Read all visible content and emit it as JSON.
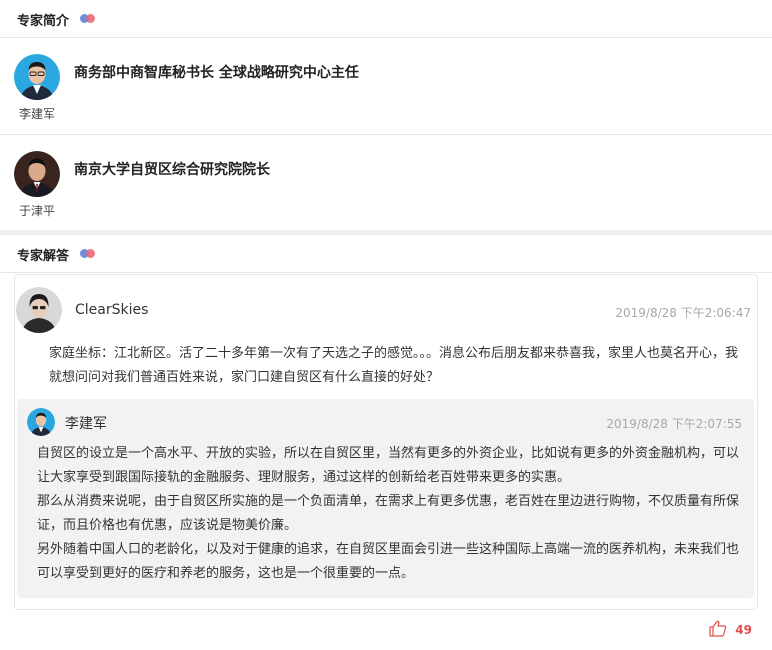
{
  "intro_section": {
    "title": "专家简介"
  },
  "experts": [
    {
      "name": "李建军",
      "title": "商务部中商智库秘书长 全球战略研究中心主任",
      "avatar_icon": "person-avatar-icon"
    },
    {
      "name": "于津平",
      "title": "南京大学自贸区综合研究院院长",
      "avatar_icon": "person-avatar-icon"
    }
  ],
  "qa_section": {
    "title": "专家解答"
  },
  "question": {
    "user": "ClearSkies",
    "time": "2019/8/28 下午2:06:47",
    "text": "家庭坐标：江北新区。活了二十多年第一次有了天选之子的感觉。。。消息公布后朋友都来恭喜我，家里人也莫名开心，我就想问问对我们普通百姓来说，家门口建自贸区有什么直接的好处？"
  },
  "answer": {
    "user": "李建军",
    "time": "2019/8/28 下午2:07:55",
    "paragraphs": [
      "自贸区的设立是一个高水平、开放的实验，所以在自贸区里，当然有更多的外资企业，比如说有更多的外资金融机构，可以让大家享受到跟国际接轨的金融服务、理财服务，通过这样的创新给老百姓带来更多的实惠。",
      "那么从消费来说呢，由于自贸区所实施的是一个负面清单，在需求上有更多优惠，老百姓在里边进行购物，不仅质量有所保证，而且价格也有优惠，应该说是物美价廉。",
      "另外随着中国人口的老龄化，以及对于健康的追求，在自贸区里面会引进一些这种国际上高端一流的医养机构，未来我们也可以享受到更好的医疗和养老的服务，这也是一个很重要的一点。"
    ]
  },
  "like": {
    "count": "49",
    "icon": "thumbs-up-icon",
    "color": "#e05050"
  },
  "colors": {
    "dot_blue": "#6f8de0",
    "dot_red": "#e36b78",
    "answer_bg": "#f2f2f2"
  }
}
